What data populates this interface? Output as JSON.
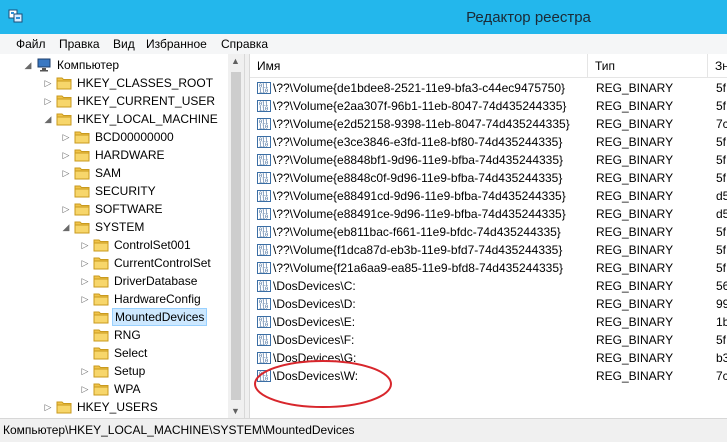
{
  "window": {
    "title": "Редактор реестра",
    "accent": "#23b7ec"
  },
  "menu": [
    "Файл",
    "Правка",
    "Вид",
    "Избранное",
    "Справка"
  ],
  "tree": [
    {
      "label": "Компьютер",
      "level": 0,
      "expander": "open",
      "icon": "computer-icon"
    },
    {
      "label": "HKEY_CLASSES_ROOT",
      "level": 1,
      "expander": "closed"
    },
    {
      "label": "HKEY_CURRENT_USER",
      "level": 1,
      "expander": "closed"
    },
    {
      "label": "HKEY_LOCAL_MACHINE",
      "level": 1,
      "expander": "open"
    },
    {
      "label": "BCD00000000",
      "level": 2,
      "expander": "closed"
    },
    {
      "label": "HARDWARE",
      "level": 2,
      "expander": "closed"
    },
    {
      "label": "SAM",
      "level": 2,
      "expander": "closed"
    },
    {
      "label": "SECURITY",
      "level": 2,
      "expander": "none"
    },
    {
      "label": "SOFTWARE",
      "level": 2,
      "expander": "closed"
    },
    {
      "label": "SYSTEM",
      "level": 2,
      "expander": "open"
    },
    {
      "label": "ControlSet001",
      "level": 3,
      "expander": "closed"
    },
    {
      "label": "CurrentControlSet",
      "level": 3,
      "expander": "closed"
    },
    {
      "label": "DriverDatabase",
      "level": 3,
      "expander": "closed"
    },
    {
      "label": "HardwareConfig",
      "level": 3,
      "expander": "closed"
    },
    {
      "label": "MountedDevices",
      "level": 3,
      "expander": "none",
      "selected": true
    },
    {
      "label": "RNG",
      "level": 3,
      "expander": "none"
    },
    {
      "label": "Select",
      "level": 3,
      "expander": "none"
    },
    {
      "label": "Setup",
      "level": 3,
      "expander": "closed"
    },
    {
      "label": "WPA",
      "level": 3,
      "expander": "closed"
    },
    {
      "label": "HKEY_USERS",
      "level": 1,
      "expander": "closed"
    }
  ],
  "columns": [
    "Имя",
    "Тип",
    "Зн"
  ],
  "values": [
    {
      "name": "\\??\\Volume{de1bdee8-2521-11e9-bfa3-c44ec9475750}",
      "type": "REG_BINARY",
      "data": "5f"
    },
    {
      "name": "\\??\\Volume{e2aa307f-96b1-11eb-8047-74d435244335}",
      "type": "REG_BINARY",
      "data": "5f"
    },
    {
      "name": "\\??\\Volume{e2d52158-9398-11eb-8047-74d435244335}",
      "type": "REG_BINARY",
      "data": "7c"
    },
    {
      "name": "\\??\\Volume{e3ce3846-e3fd-11e8-bf80-74d435244335}",
      "type": "REG_BINARY",
      "data": "5f"
    },
    {
      "name": "\\??\\Volume{e8848bf1-9d96-11e9-bfba-74d435244335}",
      "type": "REG_BINARY",
      "data": "5f"
    },
    {
      "name": "\\??\\Volume{e8848c0f-9d96-11e9-bfba-74d435244335}",
      "type": "REG_BINARY",
      "data": "5f"
    },
    {
      "name": "\\??\\Volume{e88491cd-9d96-11e9-bfba-74d435244335}",
      "type": "REG_BINARY",
      "data": "d5"
    },
    {
      "name": "\\??\\Volume{e88491ce-9d96-11e9-bfba-74d435244335}",
      "type": "REG_BINARY",
      "data": "d5"
    },
    {
      "name": "\\??\\Volume{eb811bac-f661-11e9-bfdc-74d435244335}",
      "type": "REG_BINARY",
      "data": "5f"
    },
    {
      "name": "\\??\\Volume{f1dca87d-eb3b-11e9-bfd7-74d435244335}",
      "type": "REG_BINARY",
      "data": "5f"
    },
    {
      "name": "\\??\\Volume{f21a6aa9-ea85-11e9-bfd8-74d435244335}",
      "type": "REG_BINARY",
      "data": "5f"
    },
    {
      "name": "\\DosDevices\\C:",
      "type": "REG_BINARY",
      "data": "56"
    },
    {
      "name": "\\DosDevices\\D:",
      "type": "REG_BINARY",
      "data": "99"
    },
    {
      "name": "\\DosDevices\\E:",
      "type": "REG_BINARY",
      "data": "1b"
    },
    {
      "name": "\\DosDevices\\F:",
      "type": "REG_BINARY",
      "data": "5f"
    },
    {
      "name": "\\DosDevices\\G:",
      "type": "REG_BINARY",
      "data": "b3"
    },
    {
      "name": "\\DosDevices\\W:",
      "type": "REG_BINARY",
      "data": "7c"
    }
  ],
  "status": "Компьютер\\HKEY_LOCAL_MACHINE\\SYSTEM\\MountedDevices",
  "annotation_color": "#d8262c"
}
